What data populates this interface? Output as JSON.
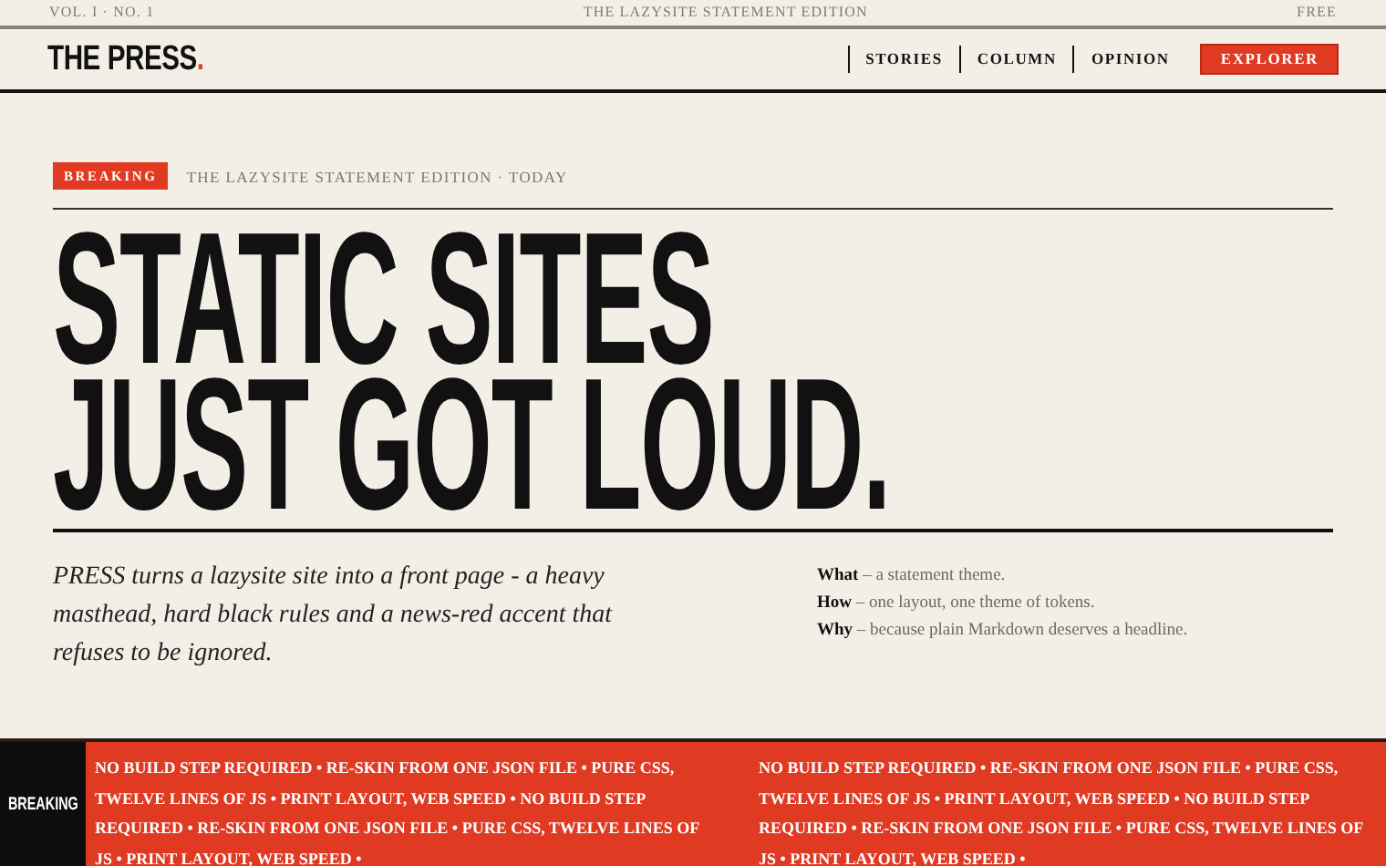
{
  "top_bar": {
    "left": "VOL. I · NO. 1",
    "center": "THE LAZYSITE STATEMENT EDITION",
    "right": "FREE"
  },
  "masthead": {
    "logo": "THE PRESS",
    "logo_mark": ".",
    "nav": [
      {
        "label": "STORIES",
        "selected": false
      },
      {
        "label": "COLUMN",
        "selected": false
      },
      {
        "label": "OPINION",
        "selected": false
      },
      {
        "label": "EXPLORER",
        "selected": true
      }
    ]
  },
  "kicker": {
    "badge": "BREAKING",
    "text": "THE LAZYSITE STATEMENT EDITION · TODAY"
  },
  "headline": [
    "STATIC SITES",
    "JUST GOT LOUD."
  ],
  "lede": "PRESS turns a lazysite site into a front page - a heavy masthead, hard black rules and a news-red accent that refuses to be ignored.",
  "facts": [
    "**What** – a statement theme.",
    "**How** – one layout, one theme of tokens.",
    "**Why** – because plain Markdown deserves a headline."
  ],
  "ticker": {
    "label": "BREAKING",
    "items": [
      "NO BUILD STEP REQUIRED • RE-SKIN FROM ONE JSON FILE • PURE CSS, TWELVE LINES OF JS • PRINT LAYOUT, WEB SPEED • NO BUILD STEP REQUIRED • RE-SKIN FROM ONE JSON FILE • PURE CSS, TWELVE LINES OF JS • PRINT LAYOUT, WEB SPEED •",
      "NO BUILD STEP REQUIRED • RE-SKIN FROM ONE JSON FILE • PURE CSS, TWELVE LINES OF JS • PRINT LAYOUT, WEB SPEED • NO BUILD STEP REQUIRED • RE-SKIN FROM ONE JSON FILE • PURE CSS, TWELVE LINES OF JS • PRINT LAYOUT, WEB SPEED •"
    ]
  }
}
